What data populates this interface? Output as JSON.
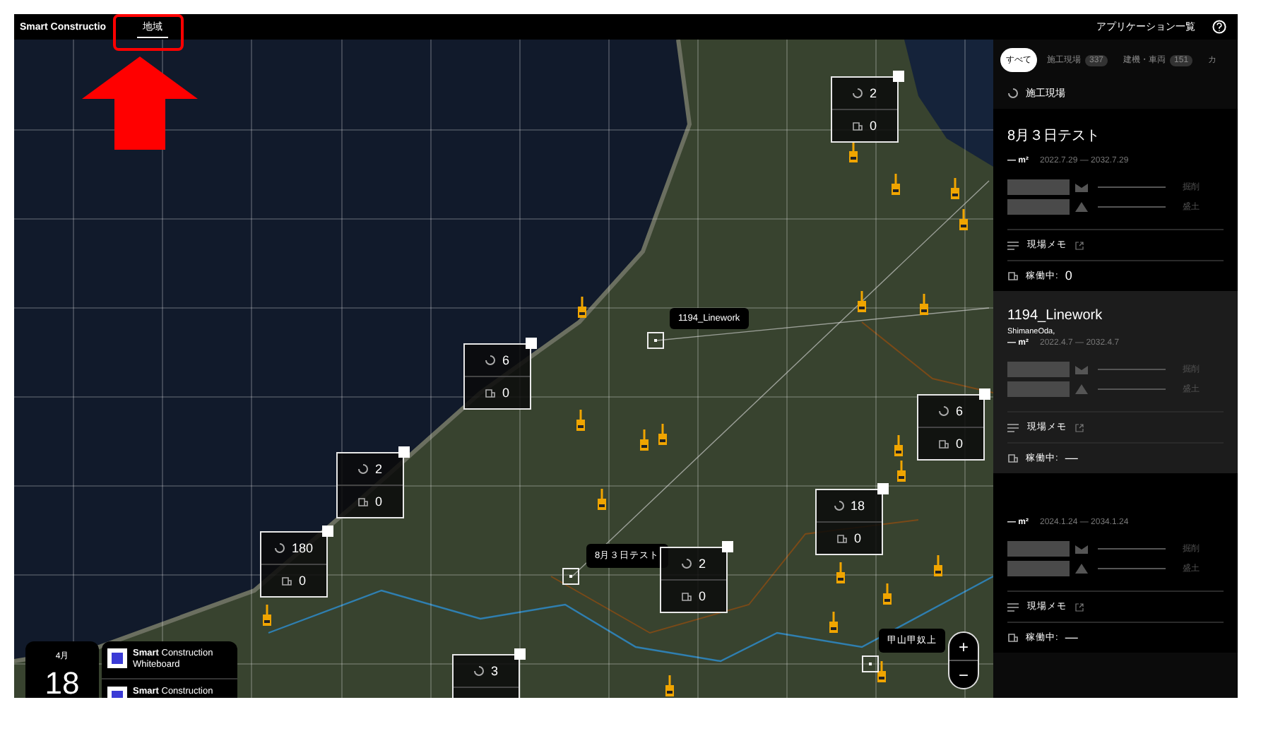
{
  "top_bar": {
    "brand": "Smart Constructio",
    "nav_item": {
      "label": "地域",
      "selected": true
    },
    "apps_link": "アプリケーション一覧"
  },
  "map": {
    "clusters": [
      {
        "sites": "2",
        "machines": "0"
      },
      {
        "sites": "6",
        "machines": "0"
      },
      {
        "sites": "2",
        "machines": "0"
      },
      {
        "sites": "180",
        "machines": "0"
      },
      {
        "sites": "2",
        "machines": "0"
      },
      {
        "sites": "18",
        "machines": "0"
      },
      {
        "sites": "6",
        "machines": "0"
      },
      {
        "sites": "3"
      }
    ],
    "site_labels": [
      "1194_Linework",
      "8月３日テスト",
      "甲山甲奴上"
    ],
    "zoom_in": "+",
    "zoom_out": "−"
  },
  "date_card": {
    "month": "4月",
    "day": "18"
  },
  "app_cards": [
    {
      "title": "**Smart** Construction",
      "subtitle": "Whiteboard"
    },
    {
      "title": "**Smart** Construction"
    }
  ],
  "panel": {
    "tabs": [
      {
        "label": "すべて",
        "selected": true
      },
      {
        "label": "施工現場",
        "count": "337",
        "selected": false
      },
      {
        "label": "建機・車両",
        "count": "151",
        "selected": false
      },
      {
        "label": "カ",
        "selected": false
      }
    ],
    "section_title": "施工現場",
    "sites": [
      {
        "name": "8月３日テスト",
        "area": "— m²",
        "period": "2022.7.29 — 2032.7.29",
        "cut_label": "掘削",
        "fill_label": "盛土",
        "memo": "現場メモ",
        "status": "稼働中:",
        "status_value": "0",
        "selected": false
      },
      {
        "name": "1194_Linework",
        "location": "ShimaneOda,",
        "area": "— m²",
        "period": "2022.4.7 — 2032.4.7",
        "cut_label": "掘削",
        "fill_label": "盛土",
        "memo": "現場メモ",
        "status": "稼働中:",
        "status_value": "—",
        "selected": true
      },
      {
        "area": "— m²",
        "period": "2024.1.24 — 2034.1.24",
        "cut_label": "掘削",
        "fill_label": "盛土",
        "memo": "現場メモ",
        "status": "稼働中:",
        "status_value": "—",
        "selected": false
      }
    ]
  }
}
